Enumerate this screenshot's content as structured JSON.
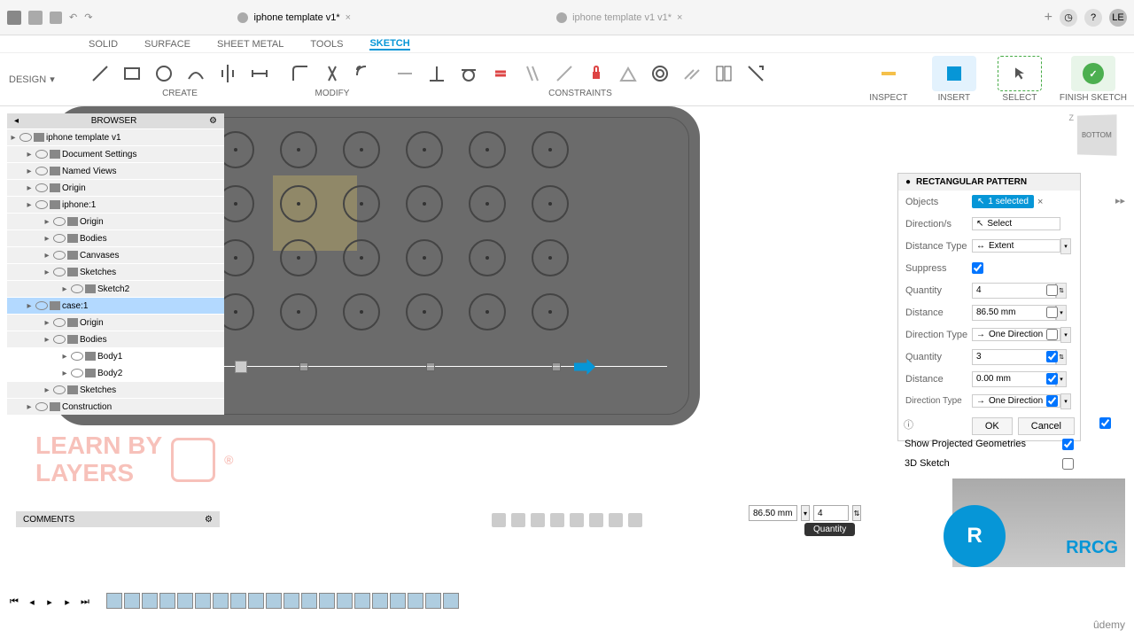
{
  "titlebar": {
    "tab1": "iphone template v1*",
    "tab2": "iphone template v1 v1*"
  },
  "ribbon": {
    "design": "DESIGN",
    "tabs": [
      "SOLID",
      "SURFACE",
      "SHEET METAL",
      "TOOLS",
      "SKETCH"
    ],
    "active": 4,
    "groups": {
      "create": "CREATE",
      "modify": "MODIFY",
      "constraints": "CONSTRAINTS",
      "inspect": "INSPECT",
      "insert": "INSERT",
      "select": "SELECT",
      "finish": "FINISH SKETCH"
    }
  },
  "browser": {
    "header": "BROWSER",
    "items": [
      {
        "label": "iphone template v1",
        "indent": 0
      },
      {
        "label": "Document Settings",
        "indent": 1
      },
      {
        "label": "Named Views",
        "indent": 1
      },
      {
        "label": "Origin",
        "indent": 1
      },
      {
        "label": "iphone:1",
        "indent": 1
      },
      {
        "label": "Origin",
        "indent": 2
      },
      {
        "label": "Bodies",
        "indent": 2
      },
      {
        "label": "Canvases",
        "indent": 2
      },
      {
        "label": "Sketches",
        "indent": 2
      },
      {
        "label": "Sketch2",
        "indent": 3
      },
      {
        "label": "case:1",
        "indent": 1,
        "sel": true
      },
      {
        "label": "Origin",
        "indent": 2
      },
      {
        "label": "Bodies",
        "indent": 2
      },
      {
        "label": "Body1",
        "indent": 3,
        "hl": true
      },
      {
        "label": "Body2",
        "indent": 3,
        "hl": true
      },
      {
        "label": "Sketches",
        "indent": 2
      },
      {
        "label": "Construction",
        "indent": 1
      }
    ]
  },
  "panel": {
    "title": "RECTANGULAR PATTERN",
    "objects_label": "Objects",
    "selected": "1 selected",
    "direction_label": "Direction/s",
    "select": "Select",
    "distance_type_label": "Distance Type",
    "extent": "Extent",
    "suppress_label": "Suppress",
    "quantity_label": "Quantity",
    "quantity1": "4",
    "distance_label": "Distance",
    "distance1": "86.50 mm",
    "direction_type_label": "Direction Type",
    "one_direction": "One Direction",
    "quantity2": "3",
    "distance2": "0.00 mm",
    "ok": "OK",
    "cancel": "Cancel"
  },
  "inline": {
    "dist": "86.50 mm",
    "qty": "4",
    "qty_label": "Quantity",
    "direction_type_label": "Direction Type",
    "one_direction": "One Direction"
  },
  "extras": {
    "show_projected": "Show Projected Geometries",
    "sketch3d": "3D Sketch",
    "finish": "Finish Sketch"
  },
  "viewcube": "BOTTOM",
  "comments": "COMMENTS",
  "watermark": {
    "line1": "LEARN BY",
    "line2": "LAYERS",
    "rrcg": "RRCG"
  },
  "udemy": "ûdemy"
}
